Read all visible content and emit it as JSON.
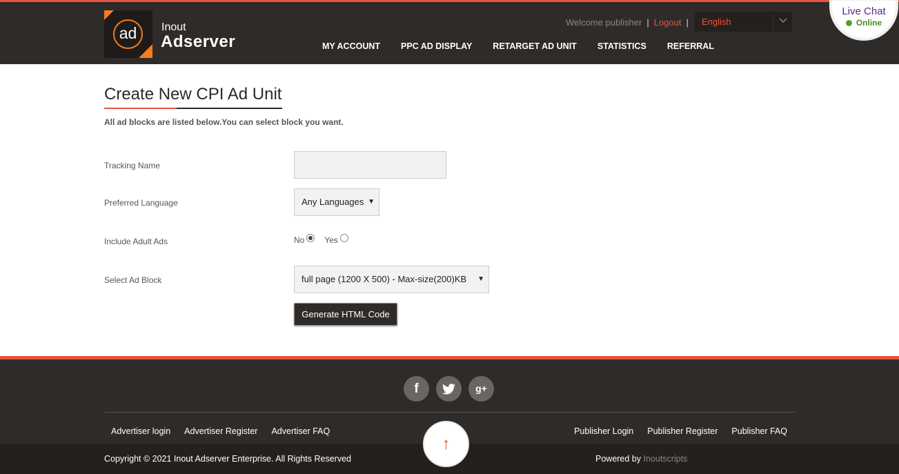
{
  "header": {
    "logo_circle_text": "ad",
    "logo_small": "Inout",
    "logo_big": "Adserver",
    "welcome": "Welcome publisher",
    "logout": "Logout",
    "language": "English",
    "nav": [
      {
        "label": "MY ACCOUNT"
      },
      {
        "label": "PPC AD DISPLAY"
      },
      {
        "label": "RETARGET AD UNIT"
      },
      {
        "label": "STATISTICS"
      },
      {
        "label": "REFERRAL"
      }
    ]
  },
  "chat": {
    "title": "Live Chat",
    "status": "Online"
  },
  "main": {
    "title": "Create New CPI Ad Unit",
    "subtitle": "All ad blocks are listed below.You can select block you want.",
    "form": {
      "tracking_label": "Tracking Name",
      "tracking_value": "",
      "language_label": "Preferred Language",
      "language_value": "Any Languages",
      "adult_label": "Include Adult Ads",
      "adult_no": "No",
      "adult_yes": "Yes",
      "adult_selected": "No",
      "block_label": "Select Ad Block",
      "block_value": "full page (1200 X 500) - Max-size(200)KB",
      "generate_button": "Generate HTML Code"
    }
  },
  "footer": {
    "social": [
      {
        "icon": "facebook-icon",
        "glyph": "f"
      },
      {
        "icon": "twitter-icon",
        "glyph": ""
      },
      {
        "icon": "google-plus-icon",
        "glyph": "g+"
      }
    ],
    "links_left": [
      "Advertiser login",
      "Advertiser Register",
      "Advertiser FAQ"
    ],
    "links_right": [
      "Publisher Login",
      "Publisher Register",
      "Publisher FAQ"
    ],
    "copyright": "Copyright © 2021 Inout Adserver Enterprise. All Rights Reserved",
    "powered_prefix": "Powered by",
    "powered_link": "Inoutscripts",
    "to_top": "↑"
  },
  "colors": {
    "accent": "#e8533f",
    "brand_orange": "#f57c1f",
    "header_bg": "#2f2b29",
    "chat_purple": "#5b2c82",
    "online_green": "#5aa02c"
  }
}
